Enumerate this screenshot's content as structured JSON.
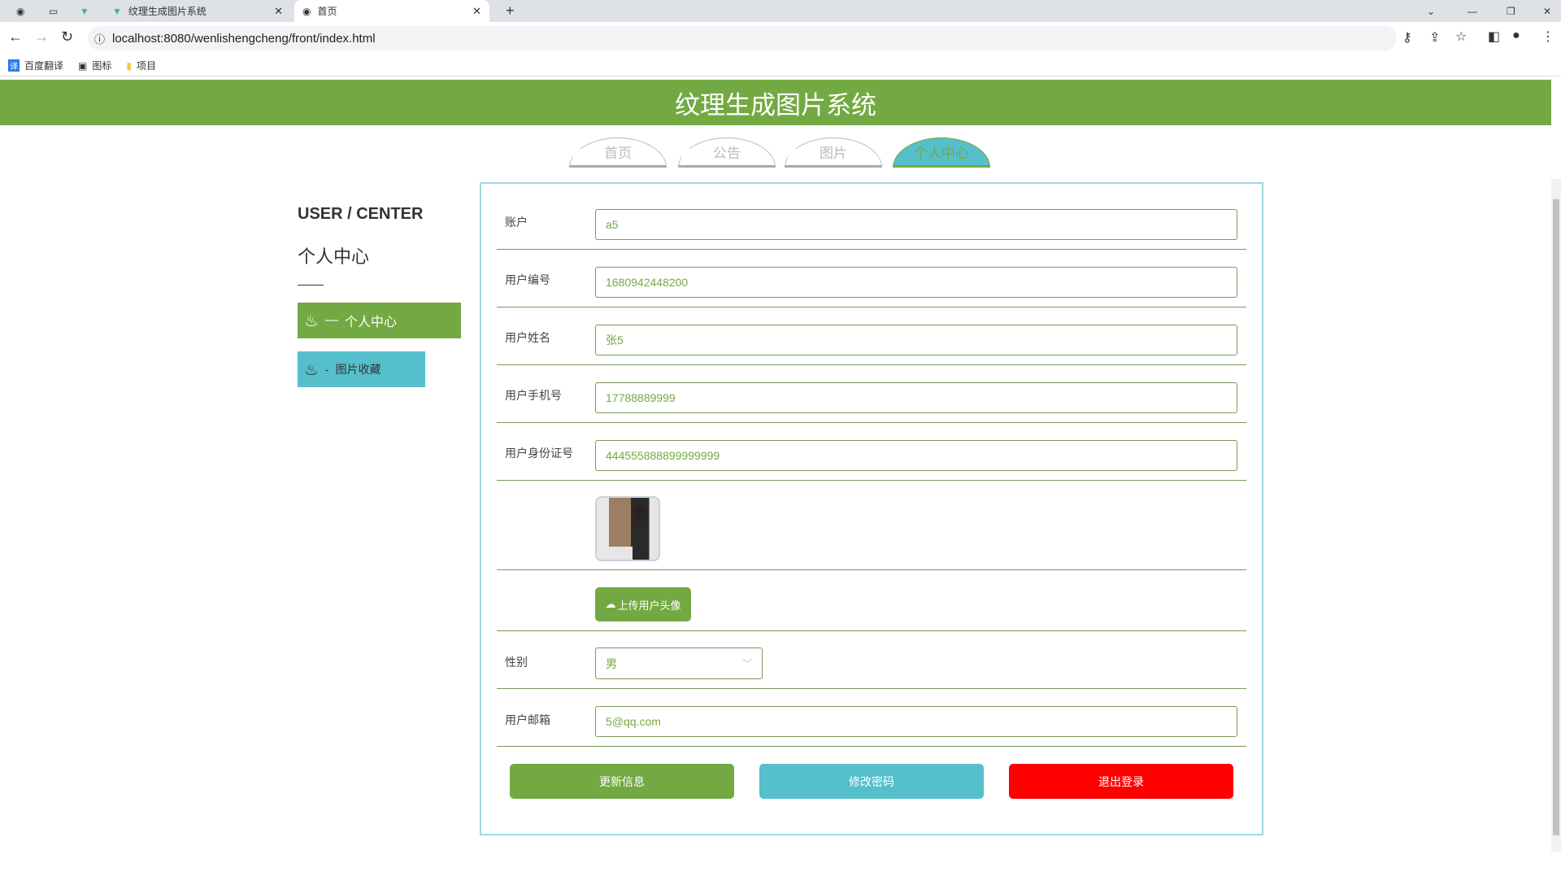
{
  "browser": {
    "tabs": [
      {
        "title": "纹理生成图片系统"
      },
      {
        "title": "首页"
      }
    ],
    "url": "localhost:8080/wenlishengcheng/front/index.html",
    "bookmarks": [
      "百度翻译",
      "图标",
      "项目"
    ]
  },
  "header": {
    "title": "纹理生成图片系统"
  },
  "nav": [
    "首页",
    "公告",
    "图片",
    "个人中心"
  ],
  "sidebar": {
    "title": "USER / CENTER",
    "subtitle": "个人中心",
    "items": [
      {
        "label": "个人中心",
        "prefix": "—"
      },
      {
        "label": "图片收藏",
        "prefix": "-"
      }
    ]
  },
  "form": {
    "account": {
      "label": "账户",
      "value": "a5"
    },
    "user_no": {
      "label": "用户编号",
      "value": "1680942448200"
    },
    "name": {
      "label": "用户姓名",
      "value": "张5"
    },
    "phone": {
      "label": "用户手机号",
      "value": "17788889999"
    },
    "id_card": {
      "label": "用户身份证号",
      "value": "444555888899999999"
    },
    "upload_label": "上传用户头像",
    "gender": {
      "label": "性别",
      "value": "男"
    },
    "email": {
      "label": "用户邮箱",
      "value": "5@qq.com"
    }
  },
  "actions": {
    "update": "更新信息",
    "change_password": "修改密码",
    "logout": "退出登录"
  },
  "colors": {
    "green": "#73a942",
    "teal": "#55bfcc",
    "red": "#ff0000"
  }
}
